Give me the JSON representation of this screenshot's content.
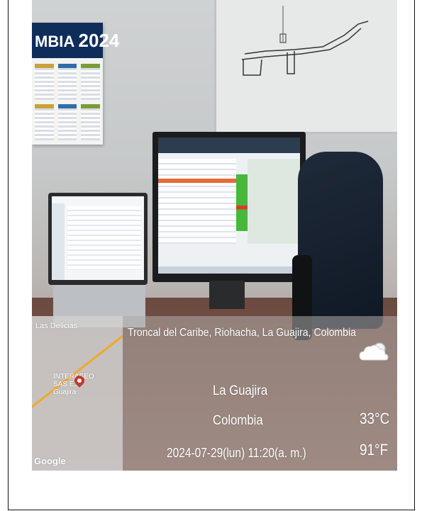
{
  "calendar": {
    "title_fragment": "MBIA",
    "year": "2024"
  },
  "overlay": {
    "map_place": "Las Delicias",
    "map_label": "INTERASEO SAS ESP Guajira",
    "map_attribution": "Google",
    "address": "Troncal del Caribe, Riohacha, La Guajira, Colombia",
    "region": "La Guajira",
    "country": "Colombia",
    "datetime": "2024-07-29(lun)  11:20(a. m.)",
    "temp_c": "33°C",
    "temp_f": "91°F",
    "weather_icon": "partly-cloudy-icon"
  },
  "colors": {
    "route": "#f0a830",
    "pin": "#c1392b",
    "calendar_header": "#0f2d5a"
  }
}
